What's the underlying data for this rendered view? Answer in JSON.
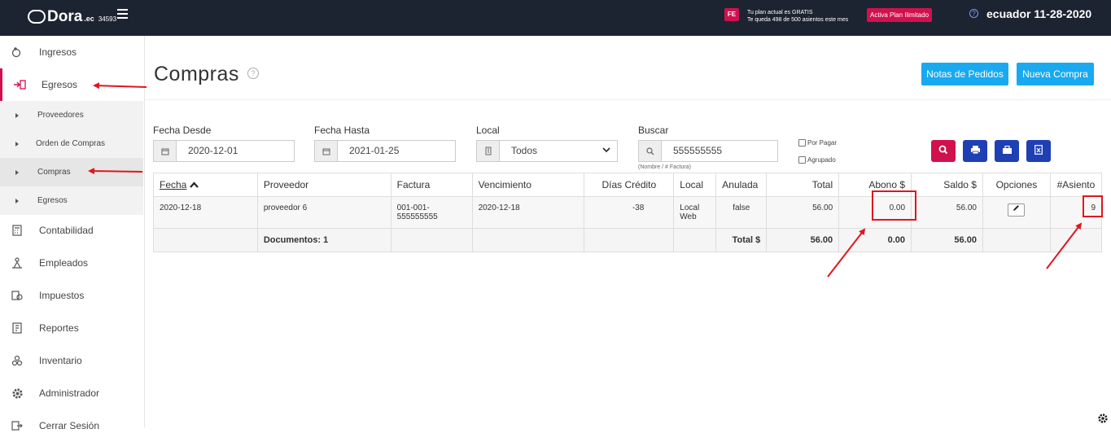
{
  "header": {
    "brand": "Dora",
    "brand_suffix": ".ec",
    "account_number": "34593",
    "fe_badge": "FE",
    "plan_line1": "Tu plan actual es GRATIS",
    "plan_line2": "Te queda 498 de 500 asientos este mes",
    "plan_button": "Activa Plan Ilimitado",
    "help_icon_glyph": "?",
    "user_date": "ecuador 11-28-2020"
  },
  "sidebar": {
    "items": [
      {
        "label": "Ingresos",
        "icon": "piggy-bank-icon"
      },
      {
        "label": "Egresos",
        "icon": "egresos-icon"
      },
      {
        "label": "Contabilidad",
        "icon": "calculator-icon"
      },
      {
        "label": "Empleados",
        "icon": "employees-icon"
      },
      {
        "label": "Impuestos",
        "icon": "taxes-icon"
      },
      {
        "label": "Reportes",
        "icon": "reports-icon"
      },
      {
        "label": "Inventario",
        "icon": "inventory-icon"
      },
      {
        "label": "Administrador",
        "icon": "gear-icon"
      },
      {
        "label": "Cerrar Sesión",
        "icon": "logout-icon"
      }
    ],
    "subitems": [
      {
        "label": "Proveedores"
      },
      {
        "label": "Orden de Compras"
      },
      {
        "label": "Compras"
      },
      {
        "label": "Egresos"
      }
    ]
  },
  "page": {
    "title": "Compras",
    "notas_button": "Notas de Pedidos",
    "nueva_button": "Nueva Compra"
  },
  "filters": {
    "desde_label": "Fecha Desde",
    "desde_value": "2020-12-01",
    "hasta_label": "Fecha Hasta",
    "hasta_value": "2021-01-25",
    "local_label": "Local",
    "local_value": "Todos",
    "buscar_label": "Buscar",
    "buscar_value": "555555555",
    "buscar_hint": "(Nombre / # Factura)",
    "por_pagar": "Por Pagar",
    "agrupado": "Agrupado"
  },
  "table": {
    "headers": [
      "Fecha",
      "Proveedor",
      "Factura",
      "Vencimiento",
      "Días Crédito",
      "Local",
      "Anulada",
      "Total",
      "Abono $",
      "Saldo $",
      "Opciones",
      "#Asiento"
    ],
    "rows": [
      {
        "fecha": "2020-12-18",
        "proveedor": "proveedor 6",
        "factura": "001-001-555555555",
        "vencimiento": "2020-12-18",
        "dias_credito": "-38",
        "local": "Local Web",
        "anulada": "false",
        "total": "56.00",
        "abono": "0.00",
        "saldo": "56.00",
        "asiento": "9"
      }
    ],
    "footer": {
      "documentos": "Documentos: 1",
      "total_label": "Total $",
      "total": "56.00",
      "abono": "0.00",
      "saldo": "56.00"
    }
  },
  "colors": {
    "topbar": "#1d2431",
    "accent_pink": "#d0114e",
    "button_blue": "#18a9f0",
    "icon_button_navy": "#1f3fb5",
    "annotation_red": "#e0161e"
  }
}
